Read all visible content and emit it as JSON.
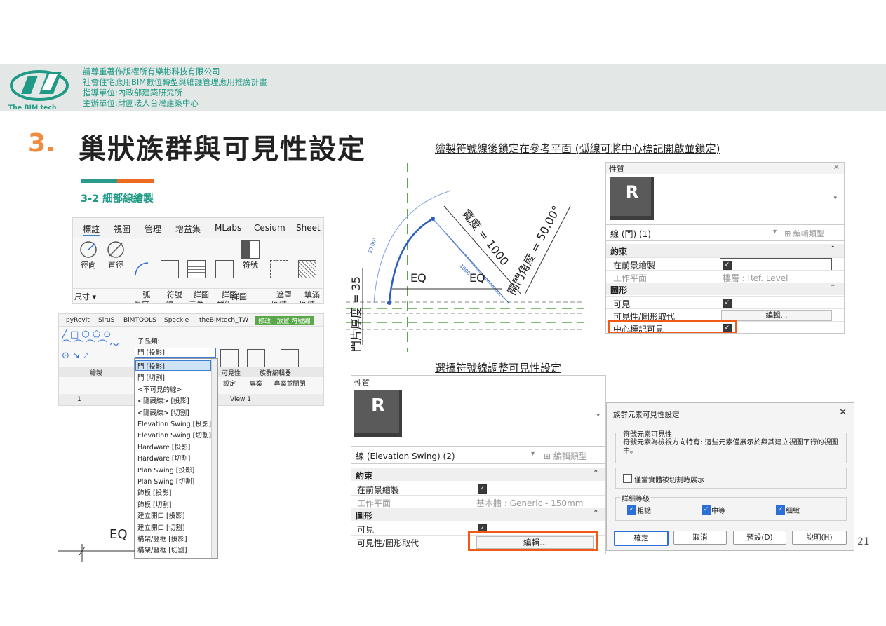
{
  "header": {
    "logo_text": "The BIM tech",
    "sponsor_lines": [
      "請尊重著作版權所有樂彬科技有限公司",
      "社會住宅應用BIM數位轉型與維護管理應用推廣計畫",
      "指導單位:內政部建築研究所",
      "主辦單位:財團法人台灣建築中心"
    ]
  },
  "title": {
    "number": "3.",
    "text": "巢狀族群與可見性設定"
  },
  "notes": {
    "top": "繪製符號線後鎖定在參考平面 (弧線可將中心標記開啟並鎖定)",
    "middle": "選擇符號線調整可見性設定"
  },
  "subheading": "3-2 細部線繪製",
  "ribbon": {
    "tabs": [
      "標註",
      "視圖",
      "管理",
      "增益集",
      "MLabs",
      "Cesium",
      "Sheet T"
    ],
    "tools": [
      "徑向",
      "直徑",
      "弧\n長度",
      "符號\n線",
      "詳圖\n元件",
      "詳圖\n群組",
      "符號",
      "遮罩\n區域",
      "填滿\n區域"
    ],
    "footer": [
      "尺寸 ▾",
      "詳圖"
    ]
  },
  "ribbon2": {
    "tabs": [
      "pyRevit",
      "SiruS",
      "BiMTOOLS",
      "Speckle",
      "theBIMtech_TW",
      "修改 | 放置 符號線"
    ],
    "subcategory_label": "子品類:",
    "subcategory_value": "門 [投影]",
    "tools": [
      "可見性\n設定",
      "載入到\n專案",
      "載入到\n專案並關閉"
    ],
    "footer": [
      "繪製",
      "可見性",
      "族群編輯器"
    ],
    "statusbar": [
      "1",
      "View 1"
    ]
  },
  "dropdown_items": [
    "門 [投影]",
    "門 [切割]",
    "<不可見的線>",
    "<隱藏線> [投影]",
    "<隱藏線> [切割]",
    "Elevation Swing [投影]",
    "Elevation Swing [切割]",
    "Hardware [投影]",
    "Hardware [切割]",
    "Plan Swing [投影]",
    "Plan Swing [切割]",
    "飾板 [投影]",
    "飾板 [切割]",
    "建立開口 [投影]",
    "建立開口 [切割]",
    "構架/豎框 [投影]",
    "構架/豎框 [切割]"
  ],
  "drawing": {
    "labels": [
      "EQ",
      "EQ",
      "寬度 = 1000",
      "開門角度 = 50.00°",
      "門片厚度 = 35",
      "50.00°",
      "1000"
    ],
    "bottom_label": "EQ"
  },
  "props_top": {
    "header": "性質",
    "icon_letter": "R",
    "type_selector": "線 (門) (1)",
    "edit_type": "編輯類型",
    "sections": [
      {
        "title": "約束",
        "rows": [
          [
            "在前景繪製",
            "checked"
          ],
          [
            "工作平面",
            "樓層 : Ref. Level"
          ]
        ]
      },
      {
        "title": "圖形",
        "rows": [
          [
            "可見",
            "checked"
          ],
          [
            "可見性/圖形取代",
            "編輯..."
          ],
          [
            "中心標記可見",
            "checked"
          ]
        ]
      }
    ]
  },
  "props_bottom": {
    "header": "性質",
    "icon_letter": "R",
    "type_selector": "線 (Elevation Swing) (2)",
    "edit_type": "編輯類型",
    "sections": [
      {
        "title": "約束",
        "rows": [
          [
            "在前景繪製",
            "checked"
          ],
          [
            "工作平面",
            "基本牆 : Generic - 150mm"
          ]
        ]
      },
      {
        "title": "圖形",
        "rows": [
          [
            "可見",
            "checked"
          ],
          [
            "可見性/圖形取代",
            "編輯..."
          ]
        ]
      }
    ]
  },
  "dialog": {
    "title": "族群元素可見性設定",
    "group1_title": "符號元素可見性",
    "group1_text": "符號元素為檢視方向特有: 這些元素僅展示於與其建立視圖平行的視圖中。",
    "only_cut_label": "僅當實體被切割時展示",
    "group2_title": "詳細等級",
    "levels": [
      "粗糙",
      "中等",
      "細緻"
    ],
    "buttons": [
      "確定",
      "取消",
      "預設(D)",
      "說明(H)"
    ]
  },
  "page_number": "21",
  "colors": {
    "accent_orange": "#f08a3c",
    "accent_teal": "#1f9a86",
    "highlight": "#f05a16"
  }
}
